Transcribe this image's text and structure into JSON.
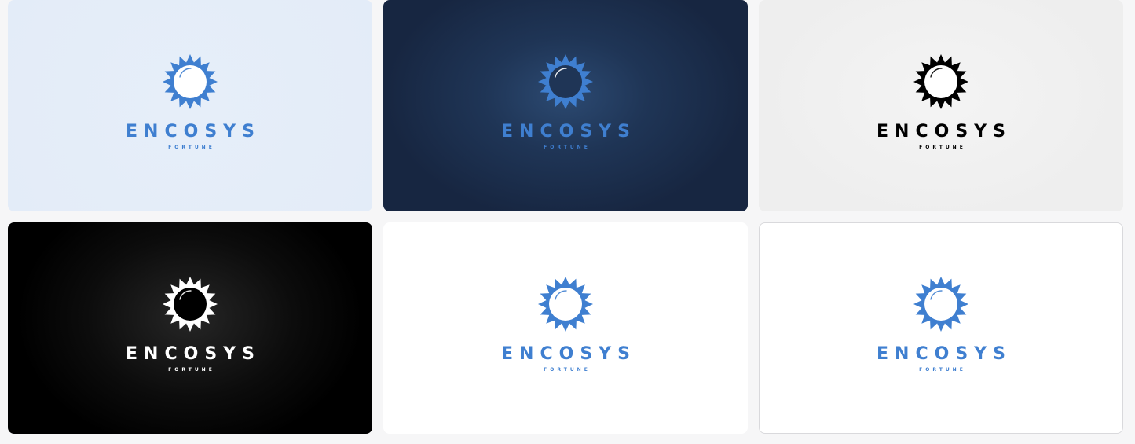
{
  "brand": {
    "name": "ENCOSYS",
    "tagline": "FORTUNE"
  },
  "logo_icon": "sunflower-icon",
  "variants": [
    {
      "background": "#e3ecf8",
      "mark": "#3f7fd0",
      "orb": "#ffffff",
      "text": "#3f7fd0"
    },
    {
      "background": "#1a2a45",
      "mark": "#3f7fd0",
      "orb": "#1f3556",
      "text": "#3f7fd0"
    },
    {
      "background": "#efefef",
      "mark": "#000000",
      "orb": "#ffffff",
      "text": "#000000"
    },
    {
      "background": "#000000",
      "mark": "#ffffff",
      "orb": "#000000",
      "text": "#ffffff"
    },
    {
      "background": "#ffffff",
      "mark": "#3f7fd0",
      "orb": "#ffffff",
      "text": "#3f7fd0"
    },
    {
      "background": "#ffffff",
      "mark": "#3f7fd0",
      "orb": "#ffffff",
      "text": "#3f7fd0",
      "bordered": true
    }
  ]
}
